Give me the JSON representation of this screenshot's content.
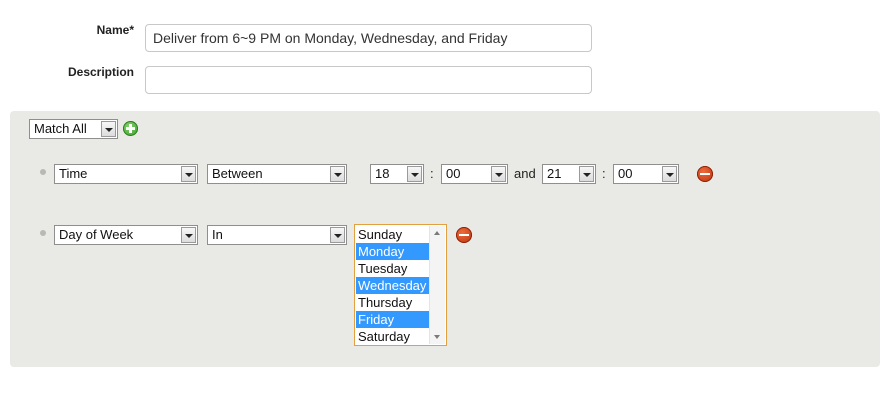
{
  "form": {
    "name_label": "Name*",
    "name_value": "Deliver from 6~9 PM on Monday, Wednesday, and Friday",
    "description_label": "Description",
    "description_value": ""
  },
  "rules": {
    "match_mode": "Match All",
    "time_rule": {
      "field": "Time",
      "operator": "Between",
      "start_hour": "18",
      "start_minute": "00",
      "and_label": "and",
      "end_hour": "21",
      "end_minute": "00",
      "colon": ":"
    },
    "day_rule": {
      "field": "Day of Week",
      "operator": "In",
      "days": [
        {
          "label": "Sunday",
          "selected": false
        },
        {
          "label": "Monday",
          "selected": true
        },
        {
          "label": "Tuesday",
          "selected": false
        },
        {
          "label": "Wednesday",
          "selected": true
        },
        {
          "label": "Thursday",
          "selected": false
        },
        {
          "label": "Friday",
          "selected": true
        },
        {
          "label": "Saturday",
          "selected": false
        }
      ]
    }
  },
  "icons": {
    "add": "plus-circle-icon",
    "remove": "minus-circle-icon"
  },
  "colors": {
    "panel_bg": "#e9e9e6",
    "selection": "#3399ff",
    "listbox_focus_border": "#e2a040",
    "add_icon": "#3c9a2a",
    "remove_icon": "#b8320f"
  }
}
